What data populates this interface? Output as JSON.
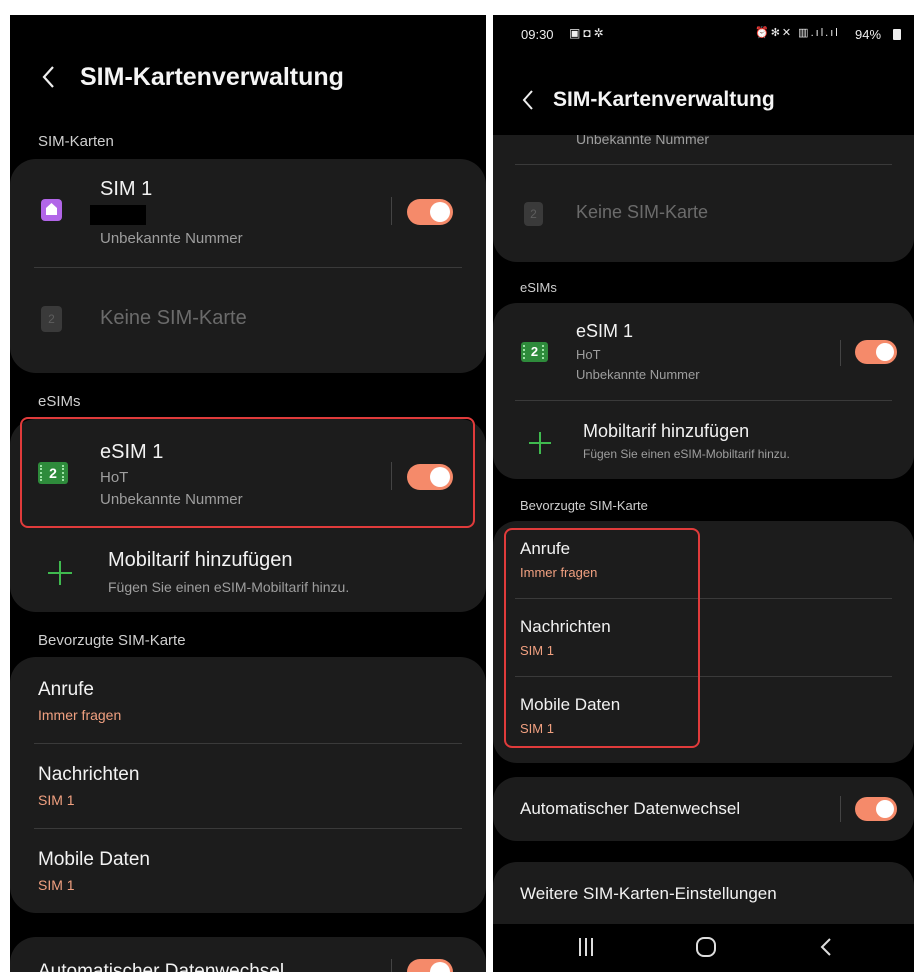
{
  "left": {
    "title": "SIM-Kartenverwaltung",
    "sim_section": "SIM-Karten",
    "sim1": {
      "name": "SIM 1",
      "number": "Unbekannte Nummer"
    },
    "no_sim": {
      "slot": "2",
      "label": "Keine SIM-Karte"
    },
    "esim_section": "eSIMs",
    "esim1": {
      "badge": "2",
      "name": "eSIM 1",
      "carrier": "HoT",
      "number": "Unbekannte Nummer"
    },
    "add_plan": {
      "title": "Mobiltarif hinzufügen",
      "subtitle": "Fügen Sie einen eSIM-Mobiltarif hinzu."
    },
    "preferred_section": "Bevorzugte SIM-Karte",
    "calls": {
      "label": "Anrufe",
      "value": "Immer fragen"
    },
    "messages": {
      "label": "Nachrichten",
      "value": "SIM 1"
    },
    "mobile_data": {
      "label": "Mobile Daten",
      "value": "SIM 1"
    },
    "auto_switch": "Automatischer Datenwechsel"
  },
  "right": {
    "status": {
      "time": "09:30",
      "battery": "94%"
    },
    "title": "SIM-Kartenverwaltung",
    "cut_number": "Unbekannte Nummer",
    "no_sim": {
      "slot": "2",
      "label": "Keine SIM-Karte"
    },
    "esim_section": "eSIMs",
    "esim1": {
      "badge": "2",
      "name": "eSIM 1",
      "carrier": "HoT",
      "number": "Unbekannte Nummer"
    },
    "add_plan": {
      "title": "Mobiltarif hinzufügen",
      "subtitle": "Fügen Sie einen eSIM-Mobiltarif hinzu."
    },
    "preferred_section": "Bevorzugte SIM-Karte",
    "calls": {
      "label": "Anrufe",
      "value": "Immer fragen"
    },
    "messages": {
      "label": "Nachrichten",
      "value": "SIM 1"
    },
    "mobile_data": {
      "label": "Mobile Daten",
      "value": "SIM 1"
    },
    "auto_switch": "Automatischer Datenwechsel",
    "more_settings": "Weitere SIM-Karten-Einstellungen"
  },
  "colors": {
    "toggle_on": "#f58a6a",
    "accent_text": "#f0a080",
    "highlight": "#e03b3b",
    "esim_green": "#2e8b3b",
    "sim_purple": "#b266e8"
  },
  "icons": [
    "back-icon",
    "home-sim-icon",
    "sim-slot-icon",
    "esim-icon",
    "plus-icon",
    "recents-icon",
    "home-icon",
    "back-nav-icon"
  ]
}
